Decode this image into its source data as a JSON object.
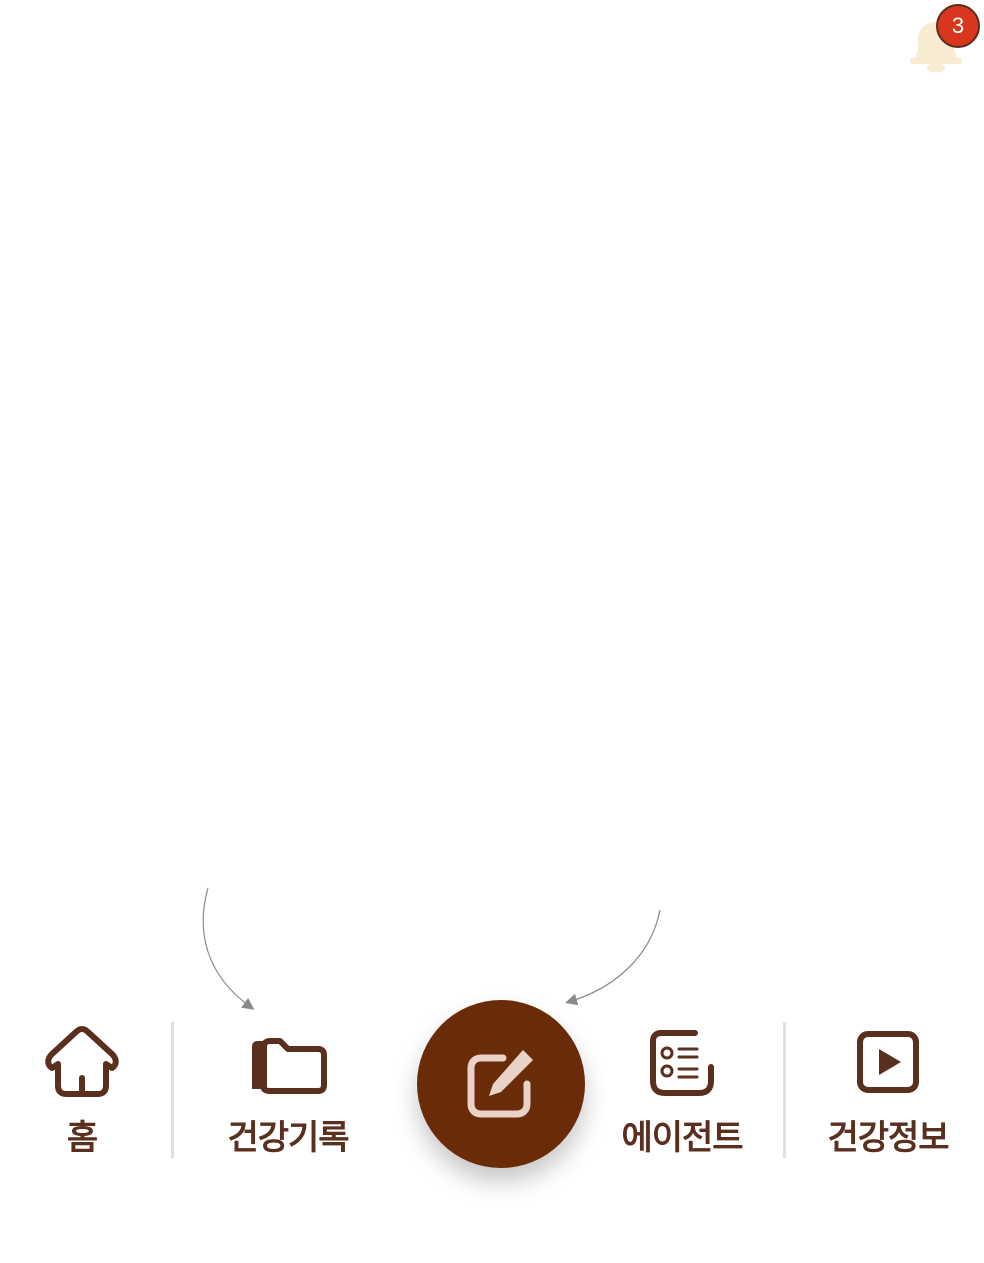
{
  "notifications": {
    "icon": "bell-icon",
    "count": "3",
    "badge_color": "#d9361f"
  },
  "nav": {
    "accent_color": "#6a2b08",
    "label_color": "#5a2f1e",
    "items": [
      {
        "label": "홈",
        "icon": "home-icon"
      },
      {
        "label": "건강기록",
        "icon": "folder-icon"
      },
      {
        "label": "에이전트",
        "icon": "list-icon"
      },
      {
        "label": "건강정보",
        "icon": "play-icon"
      }
    ],
    "fab": {
      "icon": "edit-icon"
    }
  }
}
